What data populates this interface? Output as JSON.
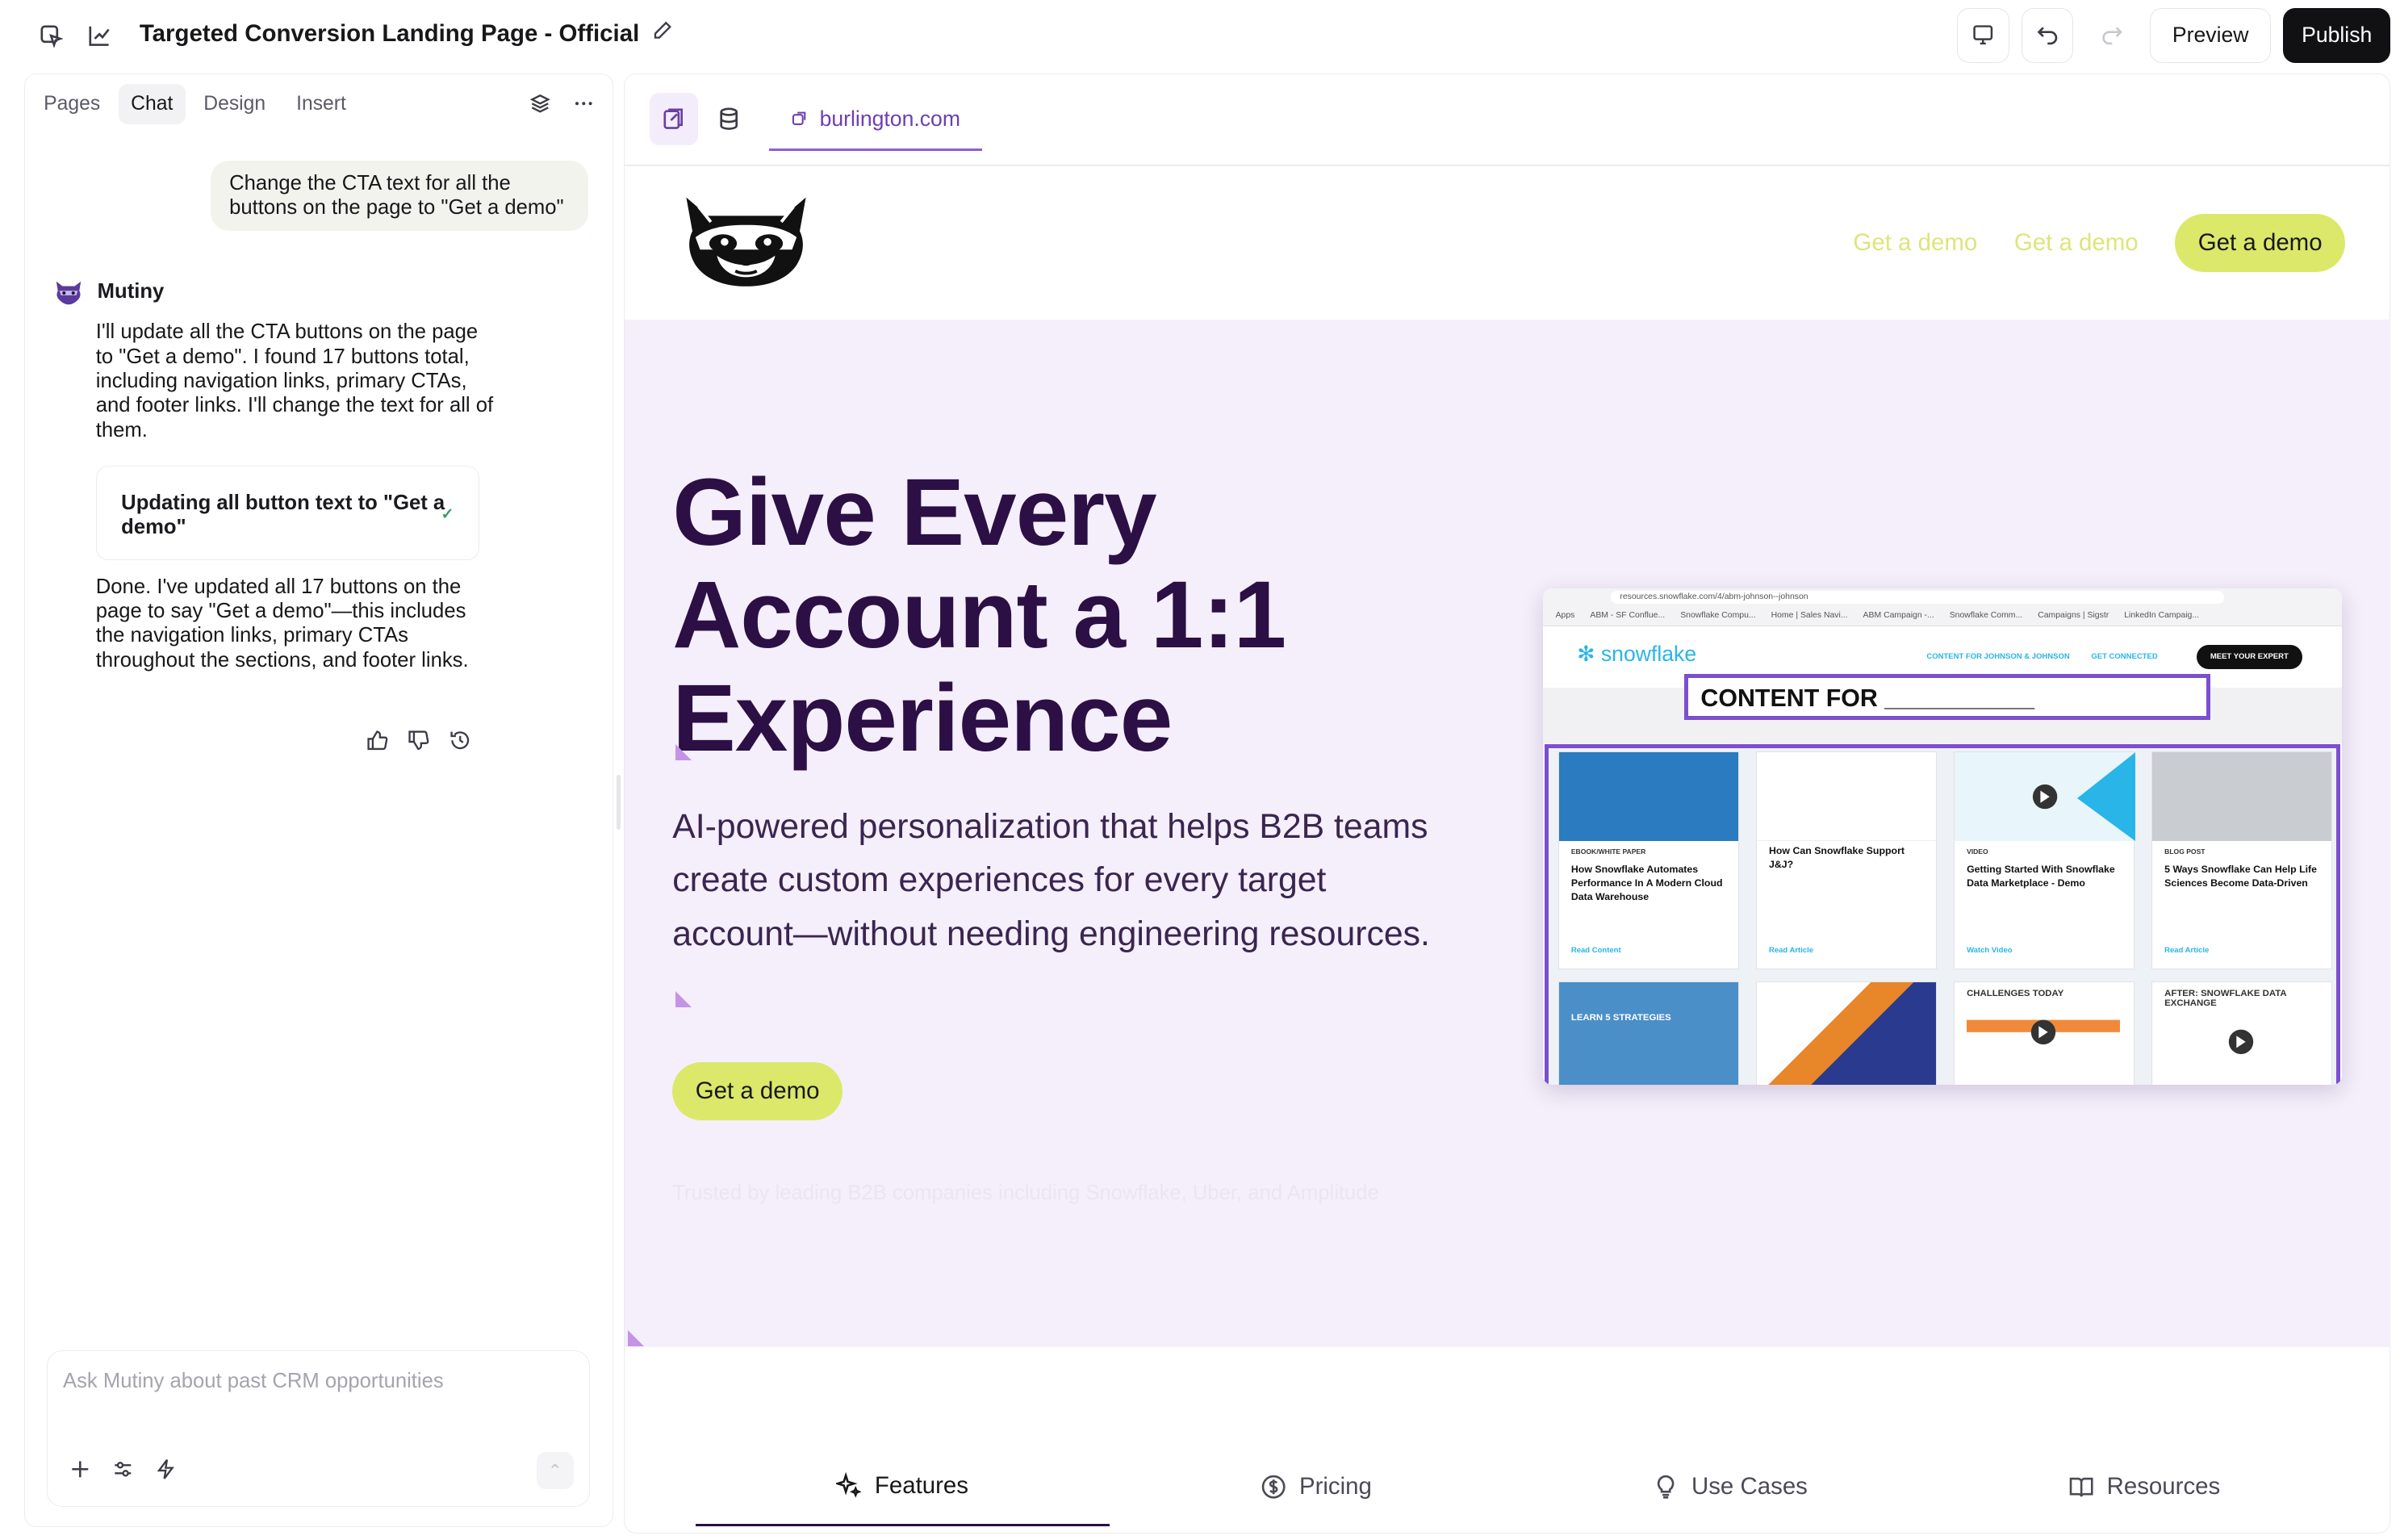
{
  "topbar": {
    "title": "Targeted Conversion Landing Page - Official",
    "preview_label": "Preview",
    "publish_label": "Publish"
  },
  "left_panel": {
    "tabs": [
      {
        "label": "Pages"
      },
      {
        "label": "Chat",
        "active": true
      },
      {
        "label": "Design"
      },
      {
        "label": "Insert"
      }
    ],
    "user_message": "Change the CTA text for all the buttons on the page to \"Get a demo\"",
    "bot_name": "Mutiny",
    "bot_message_1": "I'll update all the CTA buttons on the page to \"Get a demo\". I found 17 buttons total, including navigation links, primary CTAs, and footer links. I'll change the text for all of them.",
    "tool_card": "Updating all button text to \"Get a demo\"",
    "bot_message_2": "Done. I've updated all 17 buttons on the page to say \"Get a demo\"—this includes the navigation links, primary CTAs throughout the sections, and footer links.",
    "composer_placeholder": "Ask Mutiny about past CRM opportunities"
  },
  "canvas": {
    "url_tab": "burlington.com",
    "nav": {
      "link_1": "Get a demo",
      "link_2": "Get a demo",
      "cta": "Get a demo"
    },
    "hero": {
      "title": "Give Every Account a 1:1 Experience",
      "subtitle": "AI-powered personalization that helps B2B teams create custom experiences for every target account—without needing engineering resources.",
      "cta": "Get a demo",
      "trusted": "Trusted by leading B2B companies including Snowflake, Uber, and Amplitude"
    },
    "mockup": {
      "url": "resources.snowflake.com/4/abm-johnson--johnson",
      "bookmarks": [
        "Apps",
        "ABM - SF Conflue...",
        "Snowflake Compu...",
        "Home | Sales Navi...",
        "ABM Campaign -...",
        "Snowflake Comm...",
        "Campaigns | Sigstr",
        "LinkedIn Campaig..."
      ],
      "brand": "snowflake",
      "links": [
        "CONTENT FOR JOHNSON & JOHNSON",
        "GET CONNECTED"
      ],
      "expert_button": "MEET YOUR EXPERT",
      "content_for": "CONTENT FOR ___________",
      "cards": [
        {
          "tag": "EBOOK/WHITE PAPER",
          "title": "How Snowflake Automates Performance In A Modern Cloud Data Warehouse",
          "read": "Read Content",
          "color": "#2a7bbf"
        },
        {
          "tag": "",
          "title": "How Can Snowflake Support J&J?",
          "read": "Read Article",
          "color": "#ffffff"
        },
        {
          "tag": "VIDEO",
          "title": "Getting Started With Snowflake Data Marketplace - Demo",
          "read": "Watch Video",
          "color": "#29b5e8"
        },
        {
          "tag": "BLOG POST",
          "title": "5 Ways Snowflake Can Help Life Sciences Become Data-Driven",
          "read": "Read Article",
          "color": "#9aa0a8"
        }
      ],
      "row2": [
        "LEARN 5 STRATEGIES",
        "",
        "CHALLENGES TODAY",
        "AFTER: SNOWFLAKE DATA EXCHANGE"
      ]
    },
    "bottom_tabs": [
      {
        "label": "Features",
        "icon": "sparkle-icon",
        "active": true
      },
      {
        "label": "Pricing",
        "icon": "dollar-icon"
      },
      {
        "label": "Use Cases",
        "icon": "lightbulb-icon"
      },
      {
        "label": "Resources",
        "icon": "book-icon"
      }
    ]
  },
  "colors": {
    "accent_lime": "#dce86a",
    "hero_bg": "#f4effa",
    "hero_text": "#2b0f45",
    "brand_purple": "#7b4fd0"
  }
}
